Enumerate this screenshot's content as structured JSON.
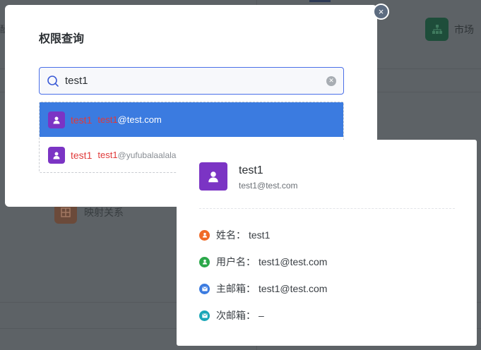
{
  "background": {
    "left_text": "酬",
    "app_market_label": "市场",
    "app_mapping_label": "映射关系"
  },
  "modal": {
    "title": "权限查询",
    "close_glyph": "×"
  },
  "search": {
    "value": "test1",
    "placeholder": ""
  },
  "results": [
    {
      "name": "test1",
      "email_highlight": "test1",
      "email_rest": "@test.com"
    },
    {
      "name": "test1",
      "email_highlight": "test1",
      "email_rest": "@yufubalaalalal"
    }
  ],
  "detail": {
    "name": "test1",
    "email": "test1@test.com",
    "fields": [
      {
        "label": "姓名：",
        "value": "test1",
        "icon": "user-icon",
        "color": "#f06a26"
      },
      {
        "label": "用户名：",
        "value": "test1@test.com",
        "icon": "user-icon",
        "color": "#2ba84a"
      },
      {
        "label": "主邮箱：",
        "value": "test1@test.com",
        "icon": "mail-icon",
        "color": "#3b7be0"
      },
      {
        "label": "次邮箱：",
        "value": "–",
        "icon": "mail-icon",
        "color": "#1aa6b7"
      }
    ]
  },
  "colors": {
    "accent": "#3b7be0",
    "avatar": "#7b34c4",
    "highlight": "#e03a3a"
  }
}
